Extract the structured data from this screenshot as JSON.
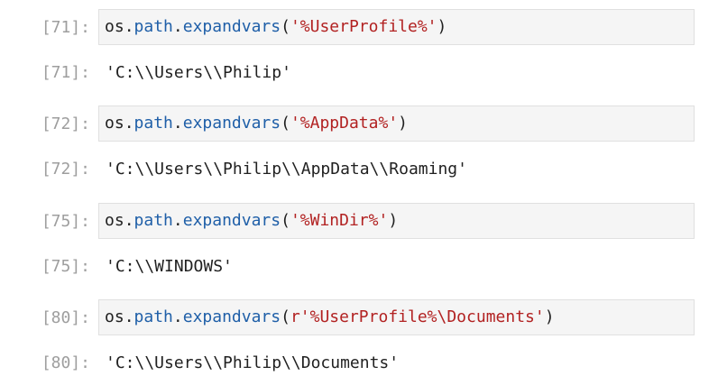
{
  "cells": [
    {
      "input_prompt": "[71]:",
      "code": {
        "module": "os",
        "dot1": ".",
        "attr1": "path",
        "dot2": ".",
        "func": "expandvars",
        "open": "(",
        "string": "'%UserProfile%'",
        "close": ")"
      },
      "output_prompt": "[71]:",
      "output": "'C:\\\\Users\\\\Philip'"
    },
    {
      "input_prompt": "[72]:",
      "code": {
        "module": "os",
        "dot1": ".",
        "attr1": "path",
        "dot2": ".",
        "func": "expandvars",
        "open": "(",
        "string": "'%AppData%'",
        "close": ")"
      },
      "output_prompt": "[72]:",
      "output": "'C:\\\\Users\\\\Philip\\\\AppData\\\\Roaming'"
    },
    {
      "input_prompt": "[75]:",
      "code": {
        "module": "os",
        "dot1": ".",
        "attr1": "path",
        "dot2": ".",
        "func": "expandvars",
        "open": "(",
        "string": "'%WinDir%'",
        "close": ")"
      },
      "output_prompt": "[75]:",
      "output": "'C:\\\\WINDOWS'"
    },
    {
      "input_prompt": "[80]:",
      "code": {
        "module": "os",
        "dot1": ".",
        "attr1": "path",
        "dot2": ".",
        "func": "expandvars",
        "open": "(",
        "string": "r'%UserProfile%\\Documents'",
        "close": ")"
      },
      "output_prompt": "[80]:",
      "output": "'C:\\\\Users\\\\Philip\\\\Documents'"
    }
  ],
  "colors": {
    "prompt": "#9e9e9e",
    "input_bg": "#f5f5f5",
    "input_border": "#e0e0e0",
    "attribute": "#1f5fa8",
    "string": "#b22222",
    "text": "#212121"
  }
}
